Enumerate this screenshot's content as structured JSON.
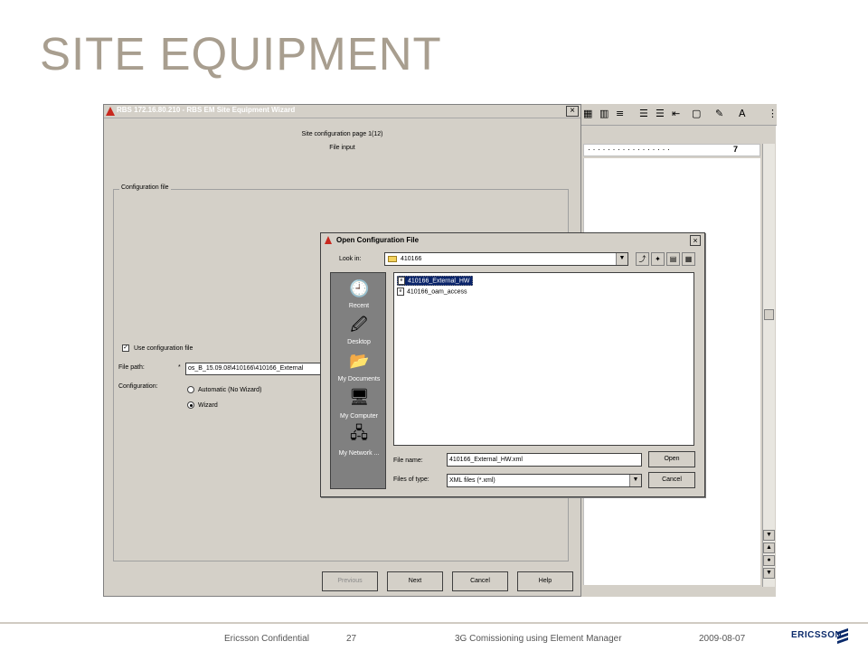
{
  "slide": {
    "title": "SITE EQUIPMENT"
  },
  "wizard": {
    "title": "RBS 172.16.80.210 - RBS EM Site Equipment Wizard",
    "page_label": "Site configuration page 1(12)",
    "subtitle": "File input",
    "group_label": "Configuration file",
    "use_config_label": "Use configuration file",
    "use_config_checked": true,
    "file_path_label": "File path:",
    "required_marker": "*",
    "file_path_value": "os_B_15.09.08\\410166\\410166_External",
    "configuration_label": "Configuration:",
    "radio_automatic": "Automatic (No Wizard)",
    "radio_wizard": "Wizard",
    "selected_mode": "Wizard",
    "buttons": {
      "previous": "Previous",
      "next": "Next",
      "cancel": "Cancel",
      "help": "Help"
    }
  },
  "dialog": {
    "title": "Open Configuration File",
    "lookin_label": "Look in:",
    "lookin_value": "410166",
    "places": [
      {
        "label": "Recent",
        "icon": "recent-icon"
      },
      {
        "label": "Desktop",
        "icon": "desktop-icon"
      },
      {
        "label": "My Documents",
        "icon": "my-documents-icon"
      },
      {
        "label": "My Computer",
        "icon": "my-computer-icon"
      },
      {
        "label": "My Network ...",
        "icon": "my-network-icon"
      }
    ],
    "files": [
      {
        "name": "410166_External_HW",
        "selected": true
      },
      {
        "name": "410166_oam_access",
        "selected": false
      }
    ],
    "filename_label": "File name:",
    "filename_value": "410166_External_HW.xml",
    "filetype_label": "Files of type:",
    "filetype_value": "XML files (*.xml)",
    "open_button": "Open",
    "cancel_button": "Cancel"
  },
  "word_ruler": {
    "mark": "7"
  },
  "footer": {
    "confidential": "Ericsson Confidential",
    "page_number": "27",
    "course": "3G Comissioning using Element Manager",
    "date": "2009-08-07",
    "logo": "ERICSSON"
  }
}
